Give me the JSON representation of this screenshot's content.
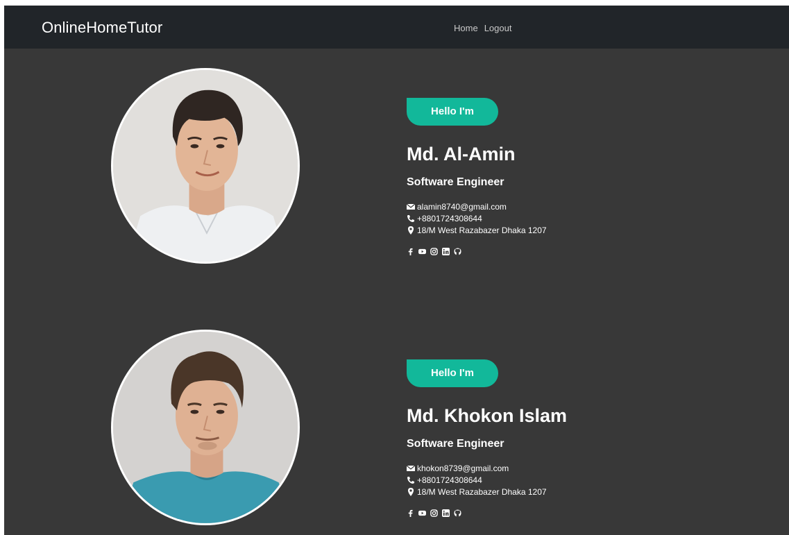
{
  "navbar": {
    "brand": "OnlineHomeTutor",
    "links": [
      {
        "label": "Home"
      },
      {
        "label": "Logout"
      }
    ]
  },
  "profiles": [
    {
      "badge": "Hello I'm",
      "name": "Md. Al-Amin",
      "title": "Software Engineer",
      "email": "alamin8740@gmail.com",
      "phone": "+8801724308644",
      "address": "18/M West Razabazer Dhaka 1207",
      "socials": [
        "facebook-icon",
        "youtube-icon",
        "instagram-icon",
        "linkedin-icon",
        "github-icon"
      ]
    },
    {
      "badge": "Hello I'm",
      "name": "Md. Khokon Islam",
      "title": "Software Engineer",
      "email": "khokon8739@gmail.com",
      "phone": "+8801724308644",
      "address": "18/M West Razabazer Dhaka 1207",
      "socials": [
        "facebook-icon",
        "youtube-icon",
        "instagram-icon",
        "linkedin-icon",
        "github-icon"
      ]
    }
  ],
  "colors": {
    "background": "#383838",
    "navbar": "#212529",
    "accent": "#12b89a"
  }
}
